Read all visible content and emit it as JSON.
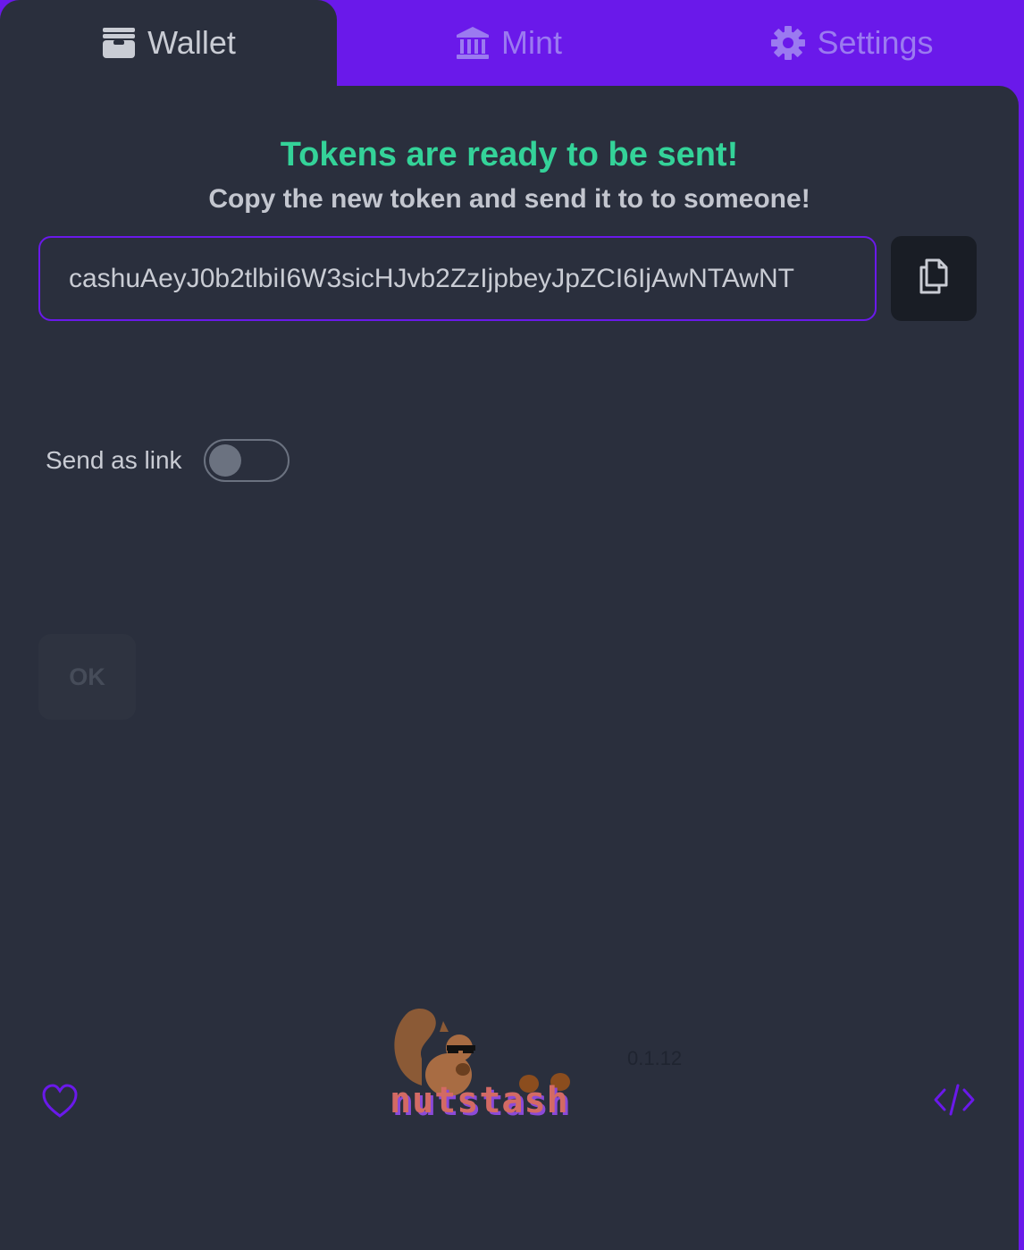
{
  "tabs": [
    {
      "label": "Wallet",
      "icon": "wallet-icon",
      "active": true
    },
    {
      "label": "Mint",
      "icon": "bank-icon",
      "active": false
    },
    {
      "label": "Settings",
      "icon": "gear-icon",
      "active": false
    }
  ],
  "send": {
    "title": "Tokens are ready to be sent!",
    "subtitle": "Copy the new token and send it to to someone!",
    "token": "cashuAeyJ0b2tlbiI6W3sicHJvb2ZzIjpbeyJpZCI6IjAwNTAwNT",
    "copy_icon": "copy-icon",
    "link_label": "Send as link",
    "link_enabled": false,
    "ok_label": "OK"
  },
  "footer": {
    "version": "0.1.12",
    "logo_text": "nutstash",
    "left_icon": "heart-icon",
    "right_icon": "code-icon"
  },
  "colors": {
    "accent": "#6a19ea",
    "success": "#34d399",
    "background": "#2a2f3d"
  }
}
